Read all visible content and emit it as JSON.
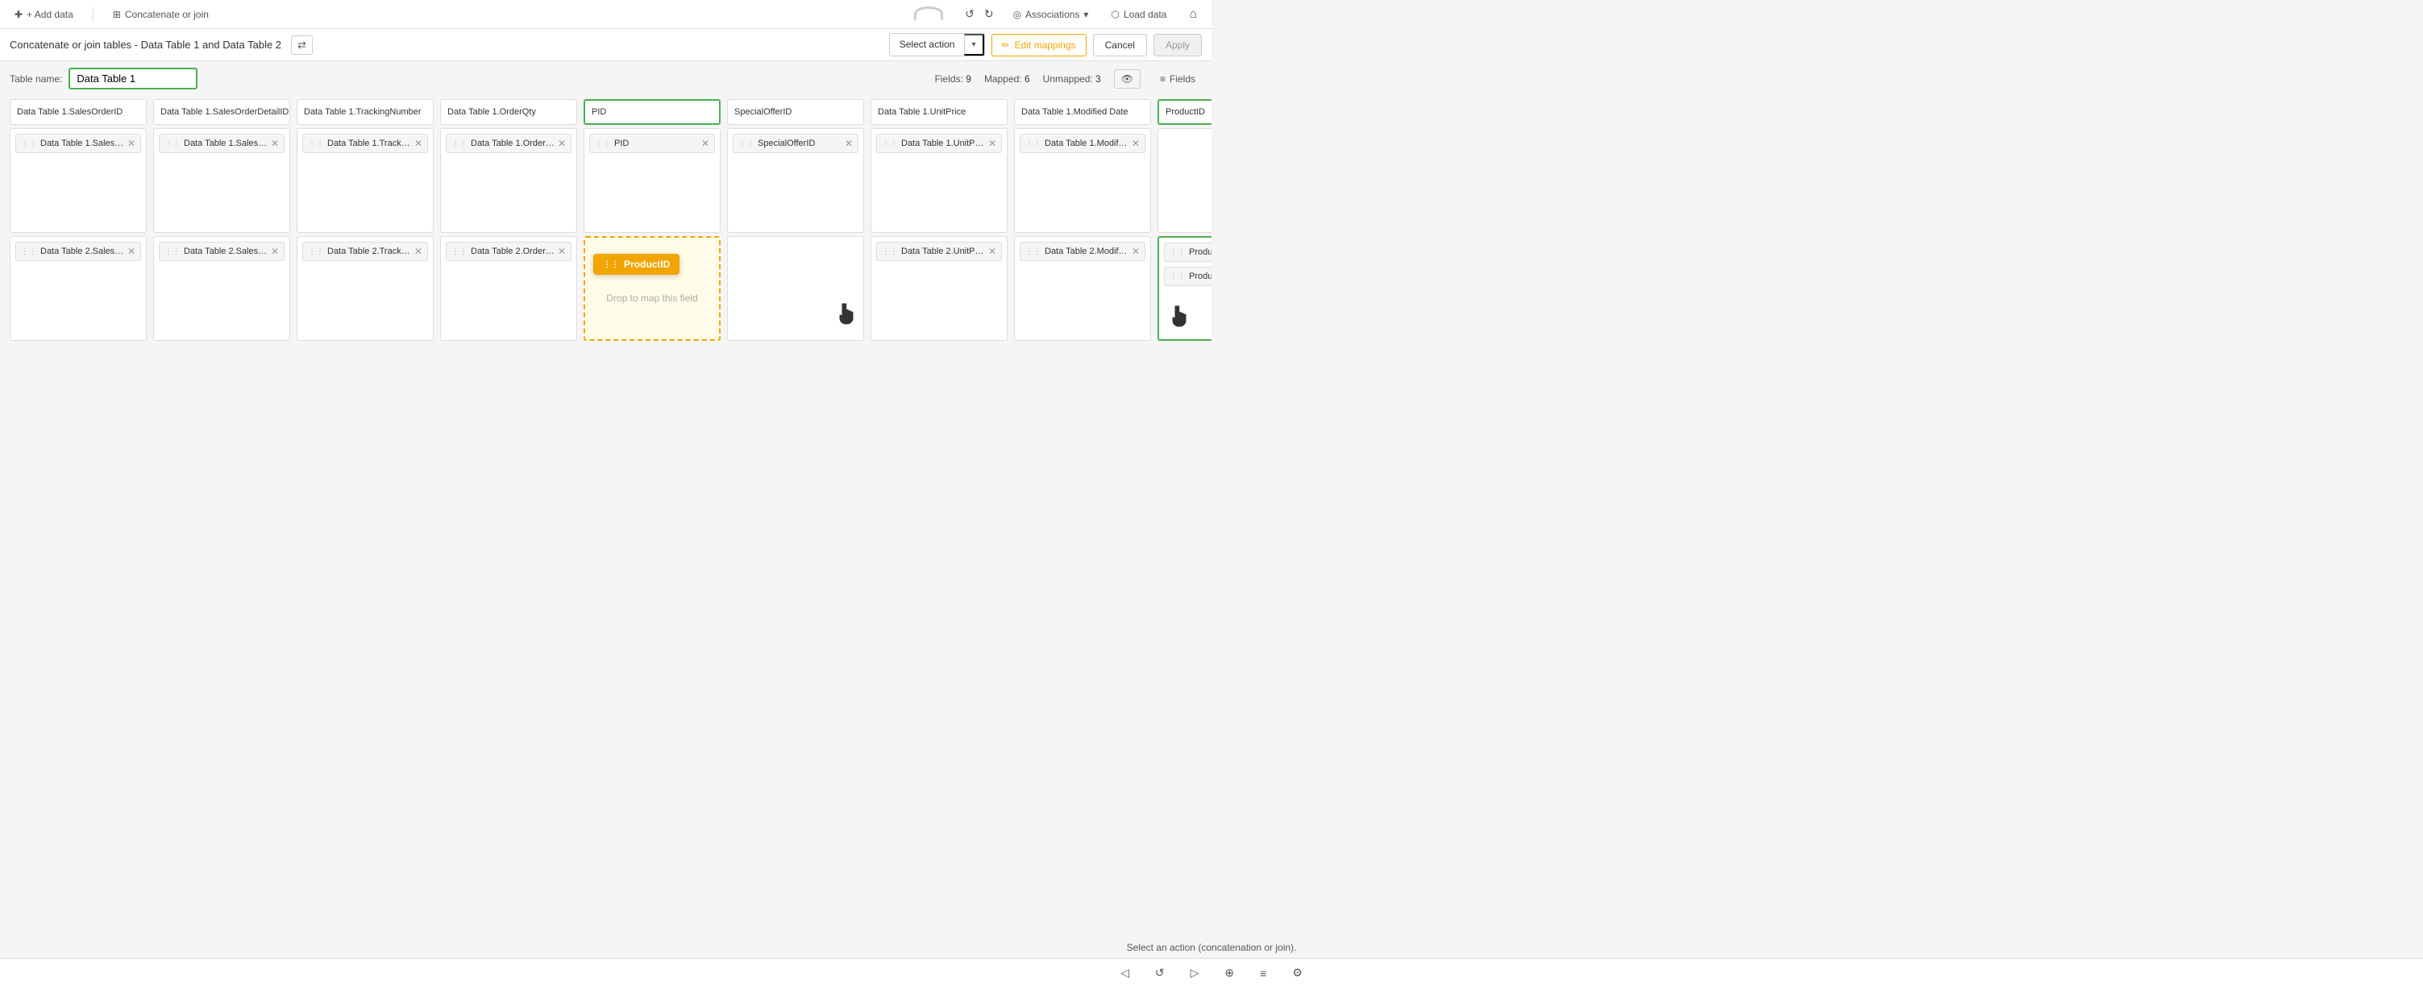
{
  "toolbar": {
    "add_data_label": "+ Add data",
    "concat_join_label": "Concatenate or join",
    "associations_label": "Associations",
    "load_data_label": "Load data",
    "home_icon": "⌂"
  },
  "second_toolbar": {
    "title": "Concatenate or join tables - Data Table 1 and Data Table 2",
    "select_action_label": "Select action",
    "edit_mappings_label": "Edit mappings",
    "cancel_label": "Cancel",
    "apply_label": "Apply"
  },
  "table_name": {
    "label": "Table name:",
    "value": "Data Table 1",
    "fields_count": "9",
    "mapped_count": "6",
    "unmapped_count": "3",
    "fields_label": "Fields"
  },
  "columns": [
    {
      "header": "Data Table 1.SalesOrderID",
      "row1_chip": "Data Table 1.SalesOrderID",
      "row2_chip": "Data Table 2.SalesOr..."
    },
    {
      "header": "Data Table 1.SalesOrderDetailID",
      "row1_chip": "Data Table 1.SalesOrder...",
      "row2_chip": "Data Table 2.SalesOr..."
    },
    {
      "header": "Data Table 1.TrackingNumber",
      "row1_chip": "Data Table 1.TrackingNu...",
      "row2_chip": "Data Table 2.Trackin..."
    },
    {
      "header": "Data Table 1.OrderQty",
      "row1_chip": "Data Table 1.OrderQty",
      "row2_chip": "Data Table 2.OrderQty"
    },
    {
      "header": "PID",
      "header_highlighted": true,
      "row1_chip": "PID",
      "row2_drop_target": true,
      "drop_floating_label": "ProductID",
      "drop_text": "Drop to map this field"
    },
    {
      "header": "SpecialOfferID",
      "row1_chip": "SpecialOfferID",
      "row2_empty": true,
      "has_cursor": true
    },
    {
      "header": "Data Table 1.UnitPrice",
      "row1_chip": "Data Table 1.UnitPrice",
      "row2_chip": "Data Table 2.UnitPrice"
    },
    {
      "header": "Data Table 1.Modified Date",
      "row1_chip": "Data Table 1.Modified Date",
      "row2_chip": "Data Table 2.Modifie..."
    },
    {
      "header": "ProductID",
      "header_highlighted": true,
      "row1_empty": true,
      "row2_chip": "ProductID",
      "row2_highlighted": true,
      "has_cursor2": true
    }
  ],
  "status_bar_text": "Select an action (concatenation or join).",
  "footer": {
    "icons": [
      "⟨",
      "↺",
      "↻",
      "⊕",
      "≡",
      "♦"
    ]
  }
}
